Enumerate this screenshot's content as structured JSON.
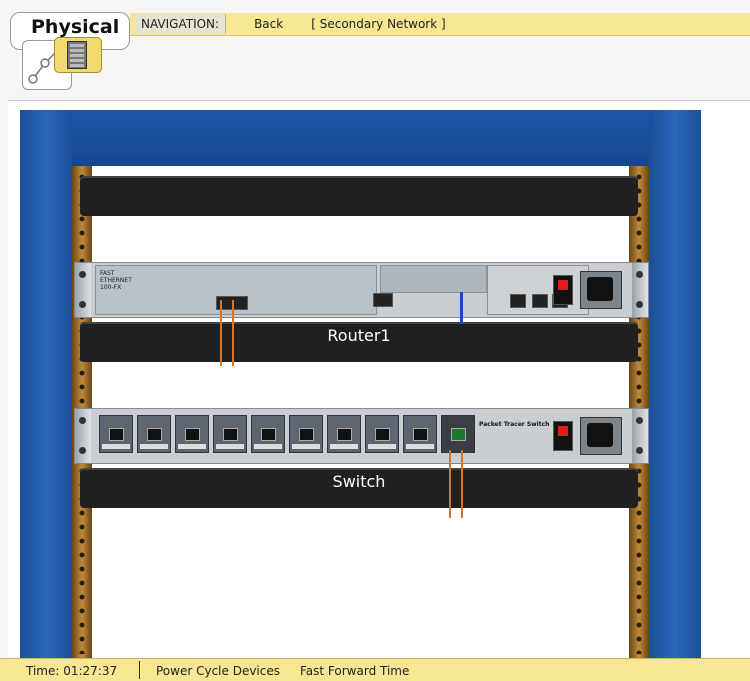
{
  "header": {
    "physical_tab": "Physical",
    "nav_label": "NAVIGATION:",
    "back_label": "Back",
    "location_label": "[ Secondary Network ]"
  },
  "rack": {
    "devices": [
      {
        "name": "Router1",
        "module_text": "FAST ETHERNET 100-FX"
      },
      {
        "name": "Switch",
        "module_text": "Packet Tracer Switch"
      }
    ]
  },
  "status": {
    "time": "Time: 01:27:37",
    "power_cycle": "Power Cycle Devices",
    "fast_forward": "Fast Forward Time"
  },
  "colors": {
    "rack_blue": "#1f57a8",
    "rail_brown": "#c08a3a",
    "nav_yellow": "#f7e692",
    "cable_orange": "#d3762a",
    "cable_blue": "#1c48c9"
  }
}
